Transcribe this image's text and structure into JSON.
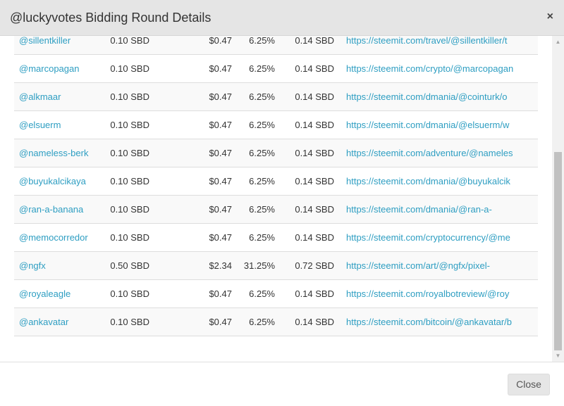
{
  "modal": {
    "title": "@luckyvotes Bidding Round Details",
    "close_icon": "×",
    "close_button": "Close"
  },
  "colors": {
    "link": "#2e9ec2",
    "header_bg": "#e5e5e5",
    "row_alt": "#f9f9f9"
  },
  "rows": [
    {
      "user": "@sillentkiller",
      "bid": "0.10 SBD",
      "usd": "$0.47",
      "pct": "6.25%",
      "sbd": "0.14 SBD",
      "url": "https://steemit.com/travel/@sillentkiller/t"
    },
    {
      "user": "@marcopagan",
      "bid": "0.10 SBD",
      "usd": "$0.47",
      "pct": "6.25%",
      "sbd": "0.14 SBD",
      "url": "https://steemit.com/crypto/@marcopagan"
    },
    {
      "user": "@alkmaar",
      "bid": "0.10 SBD",
      "usd": "$0.47",
      "pct": "6.25%",
      "sbd": "0.14 SBD",
      "url": "https://steemit.com/dmania/@cointurk/o"
    },
    {
      "user": "@elsuerm",
      "bid": "0.10 SBD",
      "usd": "$0.47",
      "pct": "6.25%",
      "sbd": "0.14 SBD",
      "url": "https://steemit.com/dmania/@elsuerm/w"
    },
    {
      "user": "@nameless-berk",
      "bid": "0.10 SBD",
      "usd": "$0.47",
      "pct": "6.25%",
      "sbd": "0.14 SBD",
      "url": "https://steemit.com/adventure/@nameles"
    },
    {
      "user": "@buyukalcikaya",
      "bid": "0.10 SBD",
      "usd": "$0.47",
      "pct": "6.25%",
      "sbd": "0.14 SBD",
      "url": "https://steemit.com/dmania/@buyukalcik"
    },
    {
      "user": "@ran-a-banana",
      "bid": "0.10 SBD",
      "usd": "$0.47",
      "pct": "6.25%",
      "sbd": "0.14 SBD",
      "url": "https://steemit.com/dmania/@ran-a-"
    },
    {
      "user": "@memocorredor",
      "bid": "0.10 SBD",
      "usd": "$0.47",
      "pct": "6.25%",
      "sbd": "0.14 SBD",
      "url": "https://steemit.com/cryptocurrency/@me"
    },
    {
      "user": "@ngfx",
      "bid": "0.50 SBD",
      "usd": "$2.34",
      "pct": "31.25%",
      "sbd": "0.72 SBD",
      "url": "https://steemit.com/art/@ngfx/pixel-"
    },
    {
      "user": "@royaleagle",
      "bid": "0.10 SBD",
      "usd": "$0.47",
      "pct": "6.25%",
      "sbd": "0.14 SBD",
      "url": "https://steemit.com/royalbotreview/@roy"
    },
    {
      "user": "@ankavatar",
      "bid": "0.10 SBD",
      "usd": "$0.47",
      "pct": "6.25%",
      "sbd": "0.14 SBD",
      "url": "https://steemit.com/bitcoin/@ankavatar/b"
    }
  ]
}
